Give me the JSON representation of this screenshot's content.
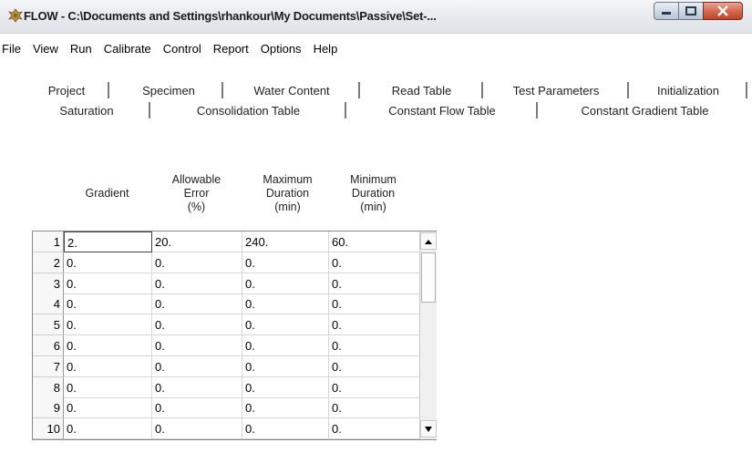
{
  "window": {
    "title": "FLOW - C:\\Documents and Settings\\rhankour\\My Documents\\Passive\\Set-...",
    "icon": "flow-app-icon",
    "controls": [
      "minimize-icon",
      "maximize-icon",
      "close-icon"
    ]
  },
  "menu": [
    {
      "label": "File"
    },
    {
      "label": "View"
    },
    {
      "label": "Run"
    },
    {
      "label": "Calibrate"
    },
    {
      "label": "Control"
    },
    {
      "label": "Report"
    },
    {
      "label": "Options"
    },
    {
      "label": "Help"
    }
  ],
  "tabs": {
    "row1": [
      {
        "label": "Project"
      },
      {
        "label": "Specimen"
      },
      {
        "label": "Water Content"
      },
      {
        "label": "Read Table"
      },
      {
        "label": "Test Parameters"
      },
      {
        "label": "Initialization"
      }
    ],
    "row2": [
      {
        "label": "Saturation"
      },
      {
        "label": "Consolidation Table"
      },
      {
        "label": "Constant Flow Table"
      },
      {
        "label": "Constant Gradient Table"
      }
    ],
    "active": "Constant Gradient Table"
  },
  "table": {
    "headers": [
      [
        "Gradient"
      ],
      [
        "Allowable",
        "Error",
        "(%)"
      ],
      [
        "Maximum",
        "Duration",
        "(min)"
      ],
      [
        "Minimum",
        "Duration",
        "(min)"
      ]
    ],
    "rows": [
      {
        "n": "1",
        "cells": [
          "2.",
          "20.",
          "240.",
          "60."
        ]
      },
      {
        "n": "2",
        "cells": [
          "0.",
          "0.",
          "0.",
          "0."
        ]
      },
      {
        "n": "3",
        "cells": [
          "0.",
          "0.",
          "0.",
          "0."
        ]
      },
      {
        "n": "4",
        "cells": [
          "0.",
          "0.",
          "0.",
          "0."
        ]
      },
      {
        "n": "5",
        "cells": [
          "0.",
          "0.",
          "0.",
          "0."
        ]
      },
      {
        "n": "6",
        "cells": [
          "0.",
          "0.",
          "0.",
          "0."
        ]
      },
      {
        "n": "7",
        "cells": [
          "0.",
          "0.",
          "0.",
          "0."
        ]
      },
      {
        "n": "8",
        "cells": [
          "0.",
          "0.",
          "0.",
          "0."
        ]
      },
      {
        "n": "9",
        "cells": [
          "0.",
          "0.",
          "0.",
          "0."
        ]
      },
      {
        "n": "10",
        "cells": [
          "0.",
          "0.",
          "0.",
          "0."
        ]
      }
    ],
    "selected_cell": "row 1, Gradient"
  },
  "colors": {
    "close_button": "#c0452c",
    "titlebar": "#e6e9ed",
    "grid_border": "#8a8a8a"
  }
}
